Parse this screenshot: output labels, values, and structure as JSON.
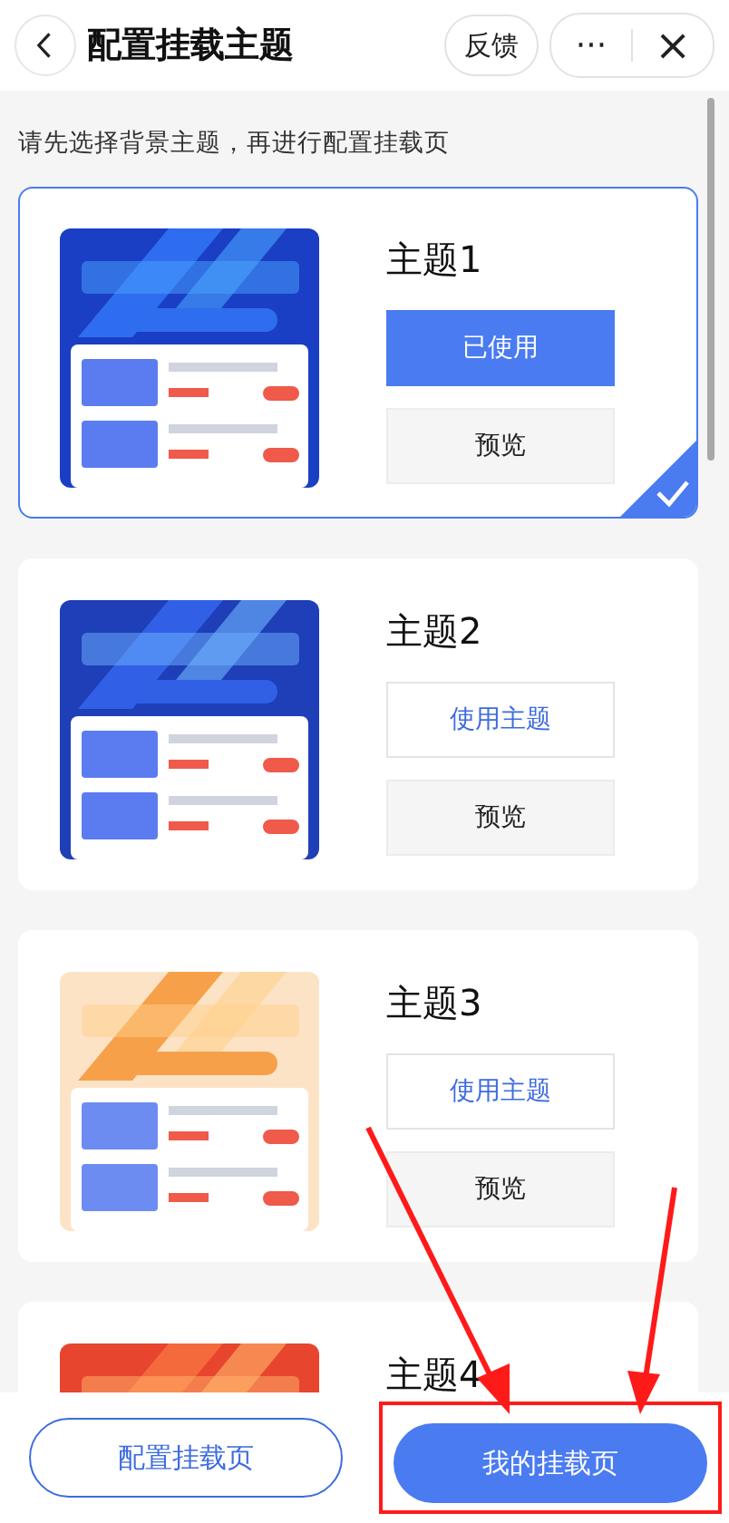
{
  "header": {
    "title": "配置挂载主题",
    "feedback": "反馈",
    "more": "···",
    "close": "×"
  },
  "hint": "请先选择背景主题，再进行配置挂载页",
  "themes": [
    {
      "title": "主题1",
      "selected": true,
      "use_button": {
        "label": "已使用",
        "in_use": true
      },
      "preview_button": "预览"
    },
    {
      "title": "主题2",
      "selected": false,
      "use_button": {
        "label": "使用主题",
        "in_use": false
      },
      "preview_button": "预览"
    },
    {
      "title": "主题3",
      "selected": false,
      "use_button": {
        "label": "使用主题",
        "in_use": false
      },
      "preview_button": "预览"
    },
    {
      "title": "主题4",
      "selected": false
    }
  ],
  "footer": {
    "buttons": [
      {
        "label": "配置挂载页",
        "kind": "outline",
        "highlighted": false
      },
      {
        "label": "我的挂载页",
        "kind": "primary",
        "highlighted": true
      }
    ]
  }
}
